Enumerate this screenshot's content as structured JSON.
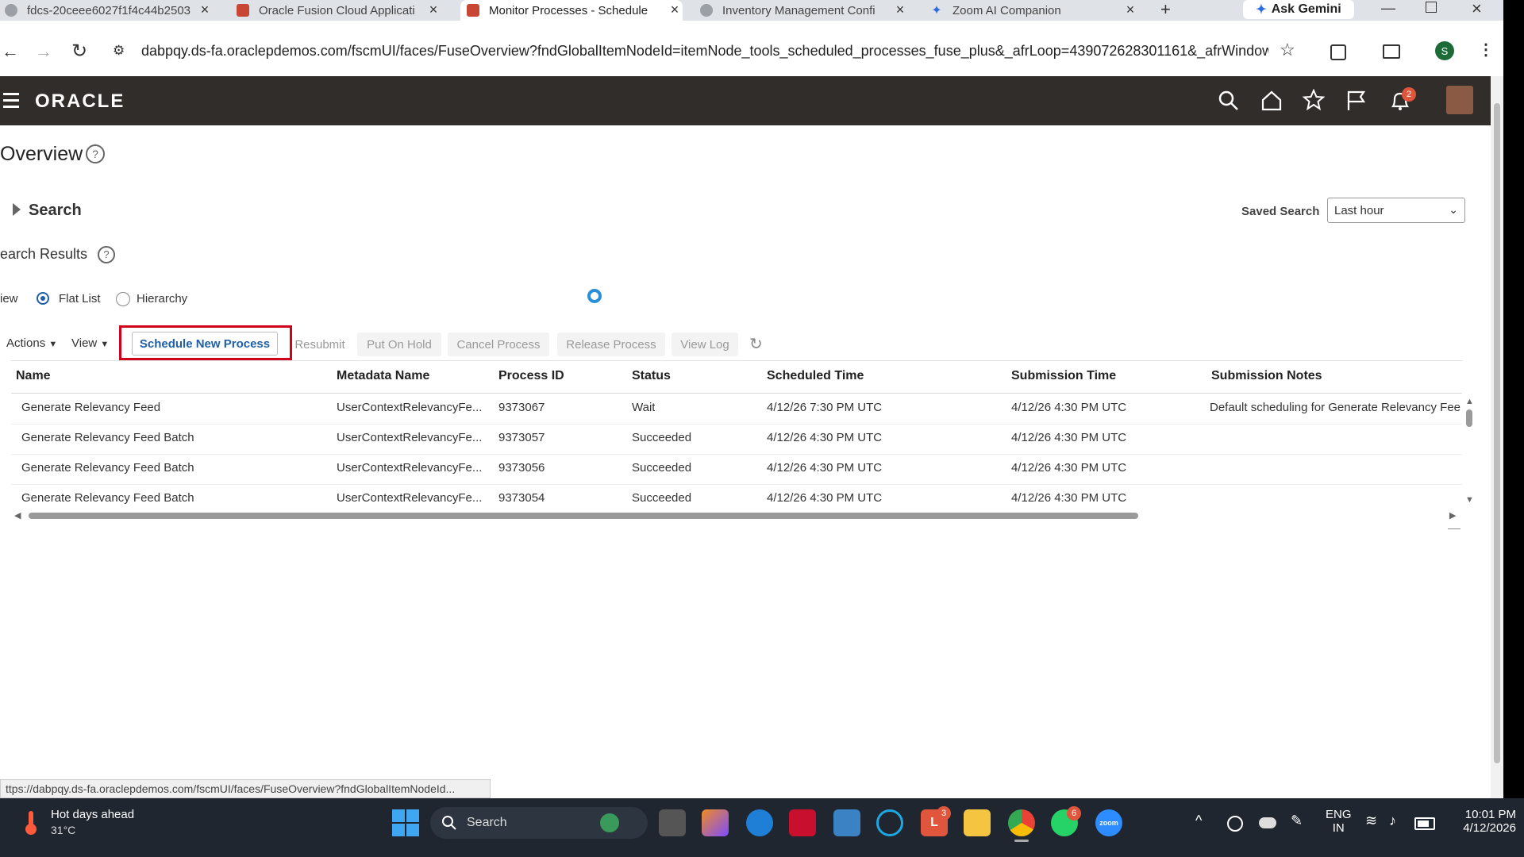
{
  "browser": {
    "tabs": [
      {
        "title": "fdcs-20ceee6027f1f4c44b2503",
        "active": false
      },
      {
        "title": "Oracle Fusion Cloud Applicati",
        "active": false
      },
      {
        "title": "Monitor Processes - Schedule",
        "active": true
      },
      {
        "title": "Inventory Management Confi",
        "active": false
      },
      {
        "title": "Zoom AI Companion",
        "active": false
      }
    ],
    "ask_gemini": "Ask Gemini",
    "url": "dabpqy.ds-fa.oraclepdemos.com/fscmUI/faces/FuseOverview?fndGlobalItemNodeId=itemNode_tools_scheduled_processes_fuse_plus&_afrLoop=439072628301161&_afrWindowMod...",
    "profile_initial": "S",
    "status_url": "ttps://dabpqy.ds-fa.oraclepdemos.com/fscmUI/faces/FuseOverview?fndGlobalItemNodeId..."
  },
  "app": {
    "logo": "ORACLE",
    "notification_count": "2",
    "page_title": "Overview",
    "search_label": "Search",
    "saved_search_label": "Saved Search",
    "saved_search_value": "Last hour",
    "results_title": "earch Results",
    "view_label": "iew",
    "view_options": [
      "Flat List",
      "Hierarchy"
    ],
    "toolbar": {
      "actions": "Actions",
      "view": "View",
      "schedule": "Schedule New Process",
      "resubmit": "Resubmit",
      "hold": "Put On Hold",
      "cancel": "Cancel Process",
      "release": "Release Process",
      "log": "View Log"
    },
    "table": {
      "headers": [
        "Name",
        "Metadata Name",
        "Process ID",
        "Status",
        "Scheduled Time",
        "Submission Time",
        "Submission Notes"
      ],
      "rows": [
        [
          "Generate Relevancy Feed",
          "UserContextRelevancyFe...",
          "9373067",
          "Wait",
          "4/12/26 7:30 PM UTC",
          "4/12/26 4:30 PM UTC",
          "Default scheduling for Generate Relevancy Fee"
        ],
        [
          "Generate Relevancy Feed Batch",
          "UserContextRelevancyFe...",
          "9373057",
          "Succeeded",
          "4/12/26 4:30 PM UTC",
          "4/12/26 4:30 PM UTC",
          ""
        ],
        [
          "Generate Relevancy Feed Batch",
          "UserContextRelevancyFe...",
          "9373056",
          "Succeeded",
          "4/12/26 4:30 PM UTC",
          "4/12/26 4:30 PM UTC",
          ""
        ],
        [
          "Generate Relevancy Feed Batch",
          "UserContextRelevancyFe...",
          "9373054",
          "Succeeded",
          "4/12/26 4:30 PM UTC",
          "4/12/26 4:30 PM UTC",
          ""
        ]
      ]
    }
  },
  "taskbar": {
    "weather_title": "Hot days ahead",
    "weather_temp": "31°C",
    "search": "Search",
    "lang1": "ENG",
    "lang2": "IN",
    "time": "10:01 PM",
    "date": "4/12/2026",
    "badge_l": "3",
    "badge_whatsapp": "6"
  },
  "colors": {
    "oracle_header": "#312d2a",
    "highlight_box": "#d0021b",
    "link_blue": "#1f5fa8"
  }
}
